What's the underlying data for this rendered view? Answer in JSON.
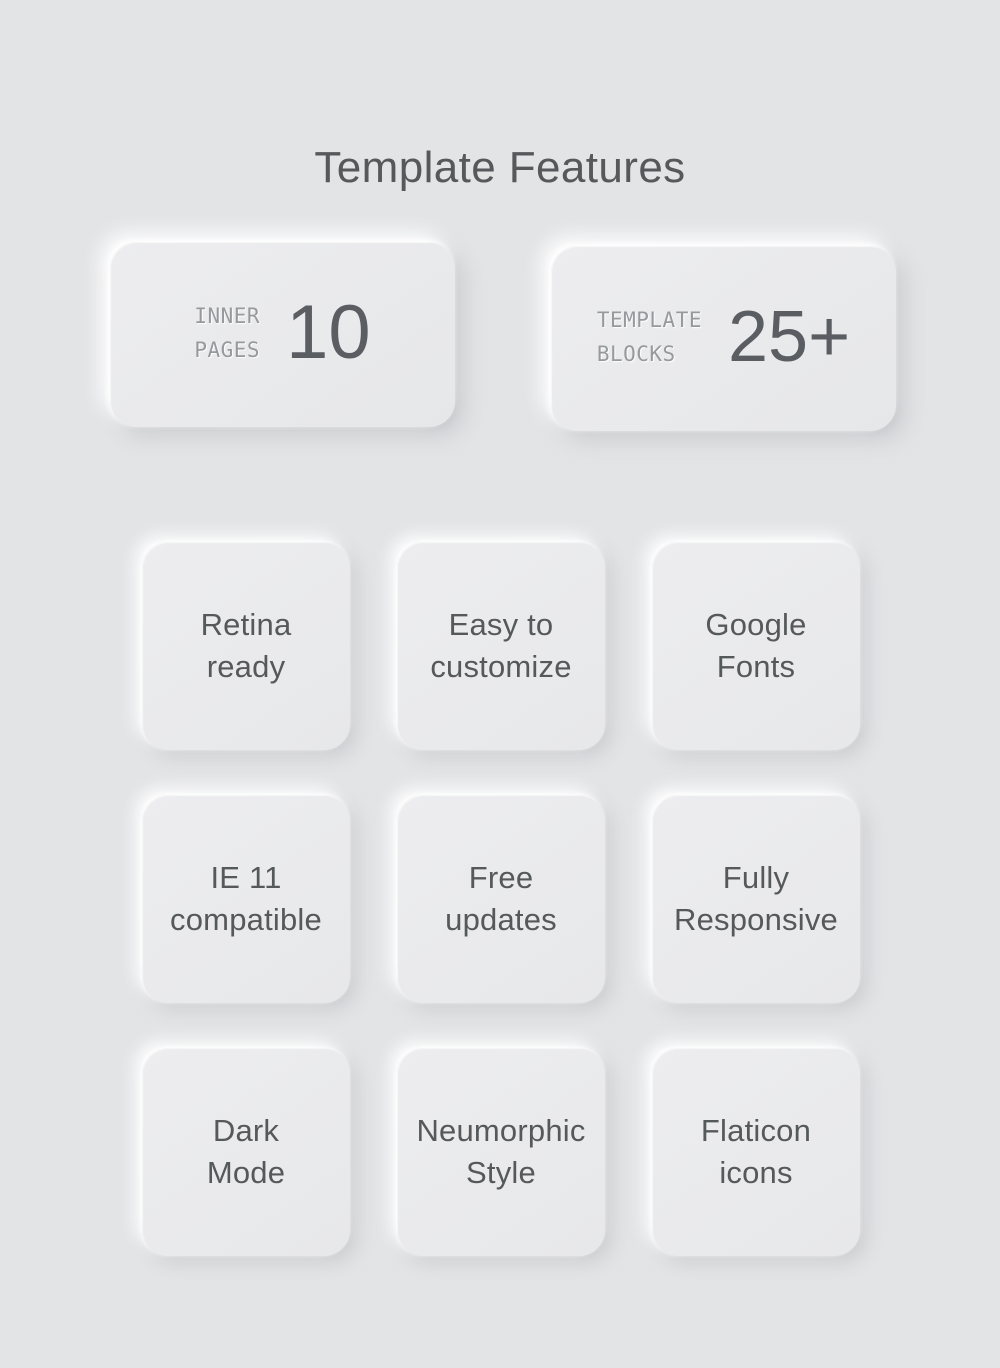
{
  "page": {
    "title": "Template Features",
    "background_color": "#e3e4e6",
    "surface_color": "#eaebed",
    "text_color": "#56595c",
    "label_color": "#96999d"
  },
  "stats": [
    {
      "label": "INNER\nPAGES",
      "value": "10"
    },
    {
      "label": "TEMPLATE\nBLOCKS",
      "value": "25+"
    }
  ],
  "features": [
    {
      "label": "Retina\nready"
    },
    {
      "label": "Easy to\ncustomize"
    },
    {
      "label": "Google\nFonts"
    },
    {
      "label": "IE 11\ncompatible"
    },
    {
      "label": "Free\nupdates"
    },
    {
      "label": "Fully\nResponsive"
    },
    {
      "label": "Dark\nMode"
    },
    {
      "label": "Neumorphic\nStyle"
    },
    {
      "label": "Flaticon\nicons"
    }
  ]
}
